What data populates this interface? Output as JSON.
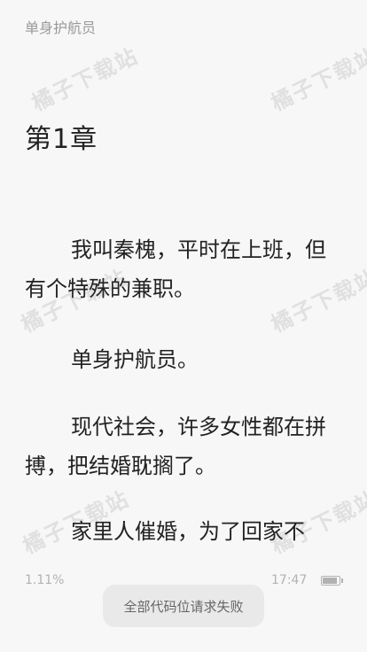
{
  "header": {
    "book_title": "单身护航员"
  },
  "chapter": {
    "title": "第1章",
    "paragraphs": [
      "我叫秦槐，平时在上班，但有个特殊的兼职。",
      "单身护航员。",
      "现代社会，许多女性都在拼搏，把结婚耽搁了。",
      "家里人催婚，为了回家不"
    ]
  },
  "watermark": {
    "text": "橘子下载站"
  },
  "footer": {
    "progress": "1.11%",
    "time": "17:47",
    "battery_level": 0.9
  },
  "toast": {
    "message": "全部代码位请求失败"
  }
}
